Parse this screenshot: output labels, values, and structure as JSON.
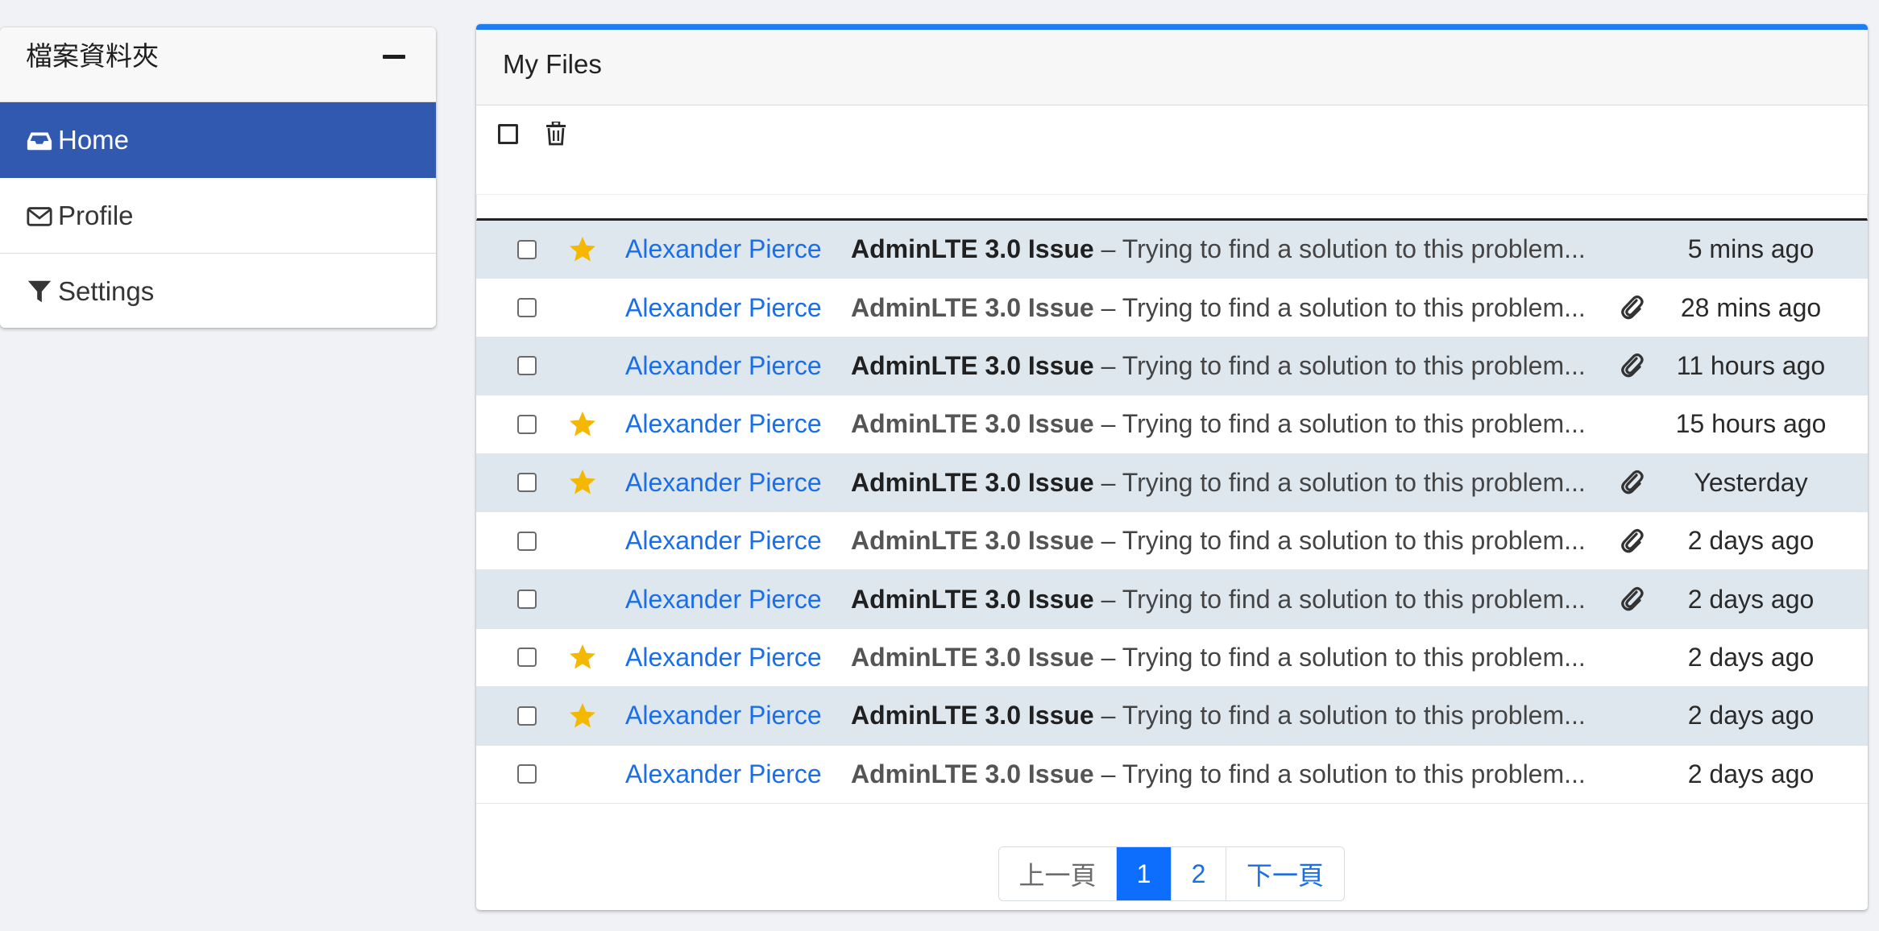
{
  "folders": {
    "title": "檔案資料夾",
    "items": [
      {
        "label": "Home",
        "icon": "inbox-icon",
        "active": true
      },
      {
        "label": "Profile",
        "icon": "envelope-icon",
        "active": false
      },
      {
        "label": "Settings",
        "icon": "filter-icon",
        "active": false
      }
    ]
  },
  "main": {
    "title": "My Files",
    "accent_color": "#1e7ef0"
  },
  "mails": [
    {
      "sender": "Alexander Pierce",
      "subject": "AdminLTE 3.0 Issue",
      "preview": " – Trying to find a solution to this problem...",
      "starred": true,
      "attachment": false,
      "date": "5 mins ago"
    },
    {
      "sender": "Alexander Pierce",
      "subject": "AdminLTE 3.0 Issue",
      "preview": " – Trying to find a solution to this problem...",
      "starred": false,
      "attachment": true,
      "date": "28 mins ago"
    },
    {
      "sender": "Alexander Pierce",
      "subject": "AdminLTE 3.0 Issue",
      "preview": " – Trying to find a solution to this problem...",
      "starred": false,
      "attachment": true,
      "date": "11 hours ago"
    },
    {
      "sender": "Alexander Pierce",
      "subject": "AdminLTE 3.0 Issue",
      "preview": " – Trying to find a solution to this problem...",
      "starred": true,
      "attachment": false,
      "date": "15 hours ago"
    },
    {
      "sender": "Alexander Pierce",
      "subject": "AdminLTE 3.0 Issue",
      "preview": " – Trying to find a solution to this problem...",
      "starred": true,
      "attachment": true,
      "date": "Yesterday"
    },
    {
      "sender": "Alexander Pierce",
      "subject": "AdminLTE 3.0 Issue",
      "preview": " – Trying to find a solution to this problem...",
      "starred": false,
      "attachment": true,
      "date": "2 days ago"
    },
    {
      "sender": "Alexander Pierce",
      "subject": "AdminLTE 3.0 Issue",
      "preview": " – Trying to find a solution to this problem...",
      "starred": false,
      "attachment": true,
      "date": "2 days ago"
    },
    {
      "sender": "Alexander Pierce",
      "subject": "AdminLTE 3.0 Issue",
      "preview": " – Trying to find a solution to this problem...",
      "starred": true,
      "attachment": false,
      "date": "2 days ago"
    },
    {
      "sender": "Alexander Pierce",
      "subject": "AdminLTE 3.0 Issue",
      "preview": " – Trying to find a solution to this problem...",
      "starred": true,
      "attachment": false,
      "date": "2 days ago"
    },
    {
      "sender": "Alexander Pierce",
      "subject": "AdminLTE 3.0 Issue",
      "preview": " – Trying to find a solution to this problem...",
      "starred": false,
      "attachment": false,
      "date": "2 days ago"
    }
  ],
  "pagination": {
    "prev": "上一頁",
    "pages": [
      "1",
      "2"
    ],
    "current": "1",
    "next": "下一頁"
  },
  "colors": {
    "active_nav": "#3159b0",
    "star": "#f5b800",
    "link": "#1a6ee8",
    "page_active": "#0d6efd"
  }
}
